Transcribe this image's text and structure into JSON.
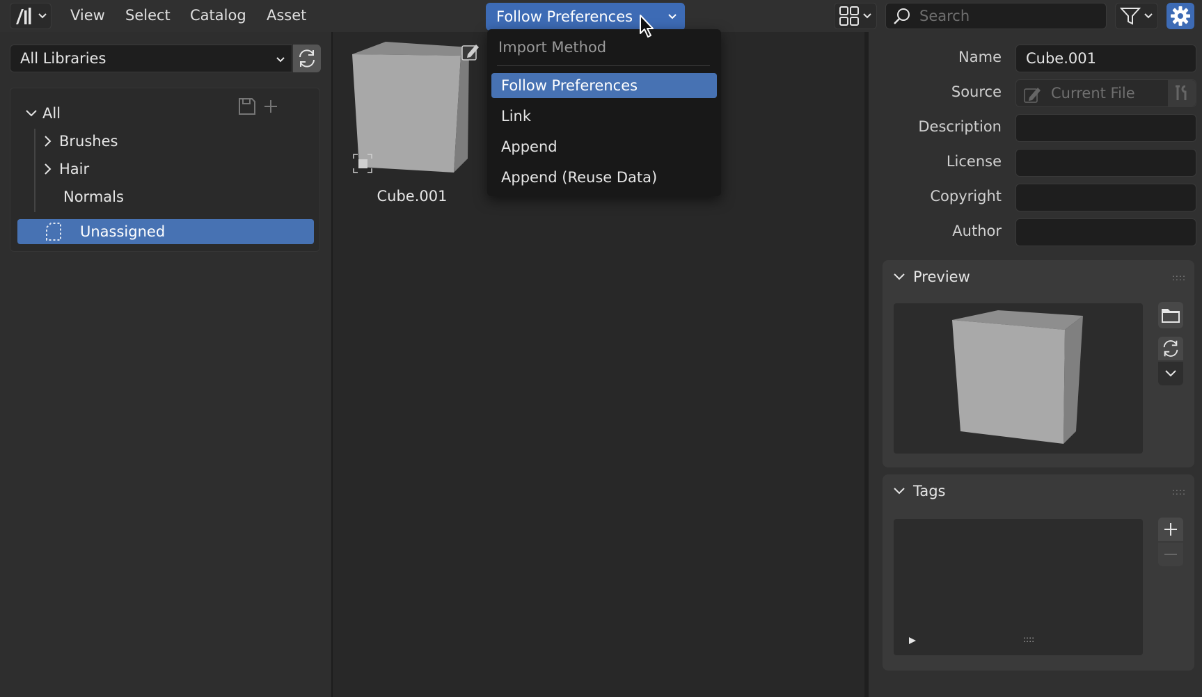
{
  "header": {
    "menu": [
      "View",
      "Select",
      "Catalog",
      "Asset"
    ],
    "import_method_value": "Follow Preferences",
    "search_placeholder": "Search"
  },
  "left_panel": {
    "library_select": "All Libraries",
    "tree": {
      "root": "All",
      "items": [
        "Brushes",
        "Hair",
        "Normals"
      ],
      "selected": "Unassigned"
    }
  },
  "center": {
    "assets": [
      {
        "name": "Cube.001"
      }
    ]
  },
  "popup": {
    "title": "Import Method",
    "options": [
      "Follow Preferences",
      "Link",
      "Append",
      "Append (Reuse Data)"
    ],
    "active_index": 0
  },
  "properties": {
    "labels": {
      "name": "Name",
      "source": "Source",
      "description": "Description",
      "license": "License",
      "copyright": "Copyright",
      "author": "Author"
    },
    "values": {
      "name": "Cube.001",
      "source": "Current File",
      "description": "",
      "license": "",
      "copyright": "",
      "author": ""
    },
    "preview_panel": "Preview",
    "tags_panel": "Tags"
  },
  "colors": {
    "accent": "#4772b3",
    "background": "#303030"
  }
}
